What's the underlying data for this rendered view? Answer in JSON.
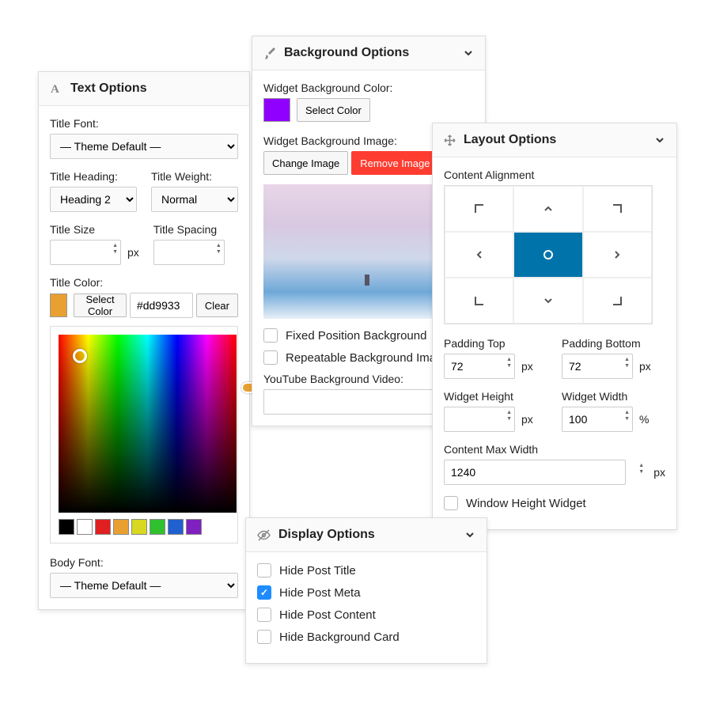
{
  "text": {
    "title": "Text Options",
    "title_font_label": "Title Font:",
    "title_font_value": "— Theme Default —",
    "title_heading_label": "Title Heading:",
    "title_heading_value": "Heading 2",
    "title_weight_label": "Title Weight:",
    "title_weight_value": "Normal",
    "title_size_label": "Title Size",
    "title_spacing_label": "Title Spacing",
    "px": "px",
    "title_color_label": "Title Color:",
    "select_color": "Select Color",
    "color_hex": "#dd9933",
    "clear": "Clear",
    "body_font_label": "Body Font:",
    "body_font_value": "— Theme Default —",
    "palette": [
      "#000000",
      "#ffffff",
      "#e02020",
      "#e8a030",
      "#d8d820",
      "#30c030",
      "#2060d0",
      "#8020c0"
    ],
    "swatch_color": "#e8a030"
  },
  "bg": {
    "title": "Background Options",
    "color_label": "Widget Background Color:",
    "select_color": "Select Color",
    "swatch_color": "#9000ff",
    "image_label": "Widget Background Image:",
    "change_image": "Change Image",
    "remove_image": "Remove Image",
    "fixed_label": "Fixed Position Background",
    "repeat_label": "Repeatable Background Image",
    "video_label": "YouTube Background Video:"
  },
  "layout": {
    "title": "Layout Options",
    "align_label": "Content Alignment",
    "pad_top_label": "Padding Top",
    "pad_top": "72",
    "pad_bot_label": "Padding Bottom",
    "pad_bot": "72",
    "height_label": "Widget Height",
    "width_label": "Widget Width",
    "width": "100",
    "pct": "%",
    "px": "px",
    "cmw_label": "Content Max Width",
    "cmw": "1240",
    "window_height": "Window Height Widget"
  },
  "display": {
    "title": "Display Options",
    "items": [
      {
        "label": "Hide Post Title",
        "checked": false
      },
      {
        "label": "Hide Post Meta",
        "checked": true
      },
      {
        "label": "Hide Post Content",
        "checked": false
      },
      {
        "label": "Hide Background Card",
        "checked": false
      }
    ]
  }
}
